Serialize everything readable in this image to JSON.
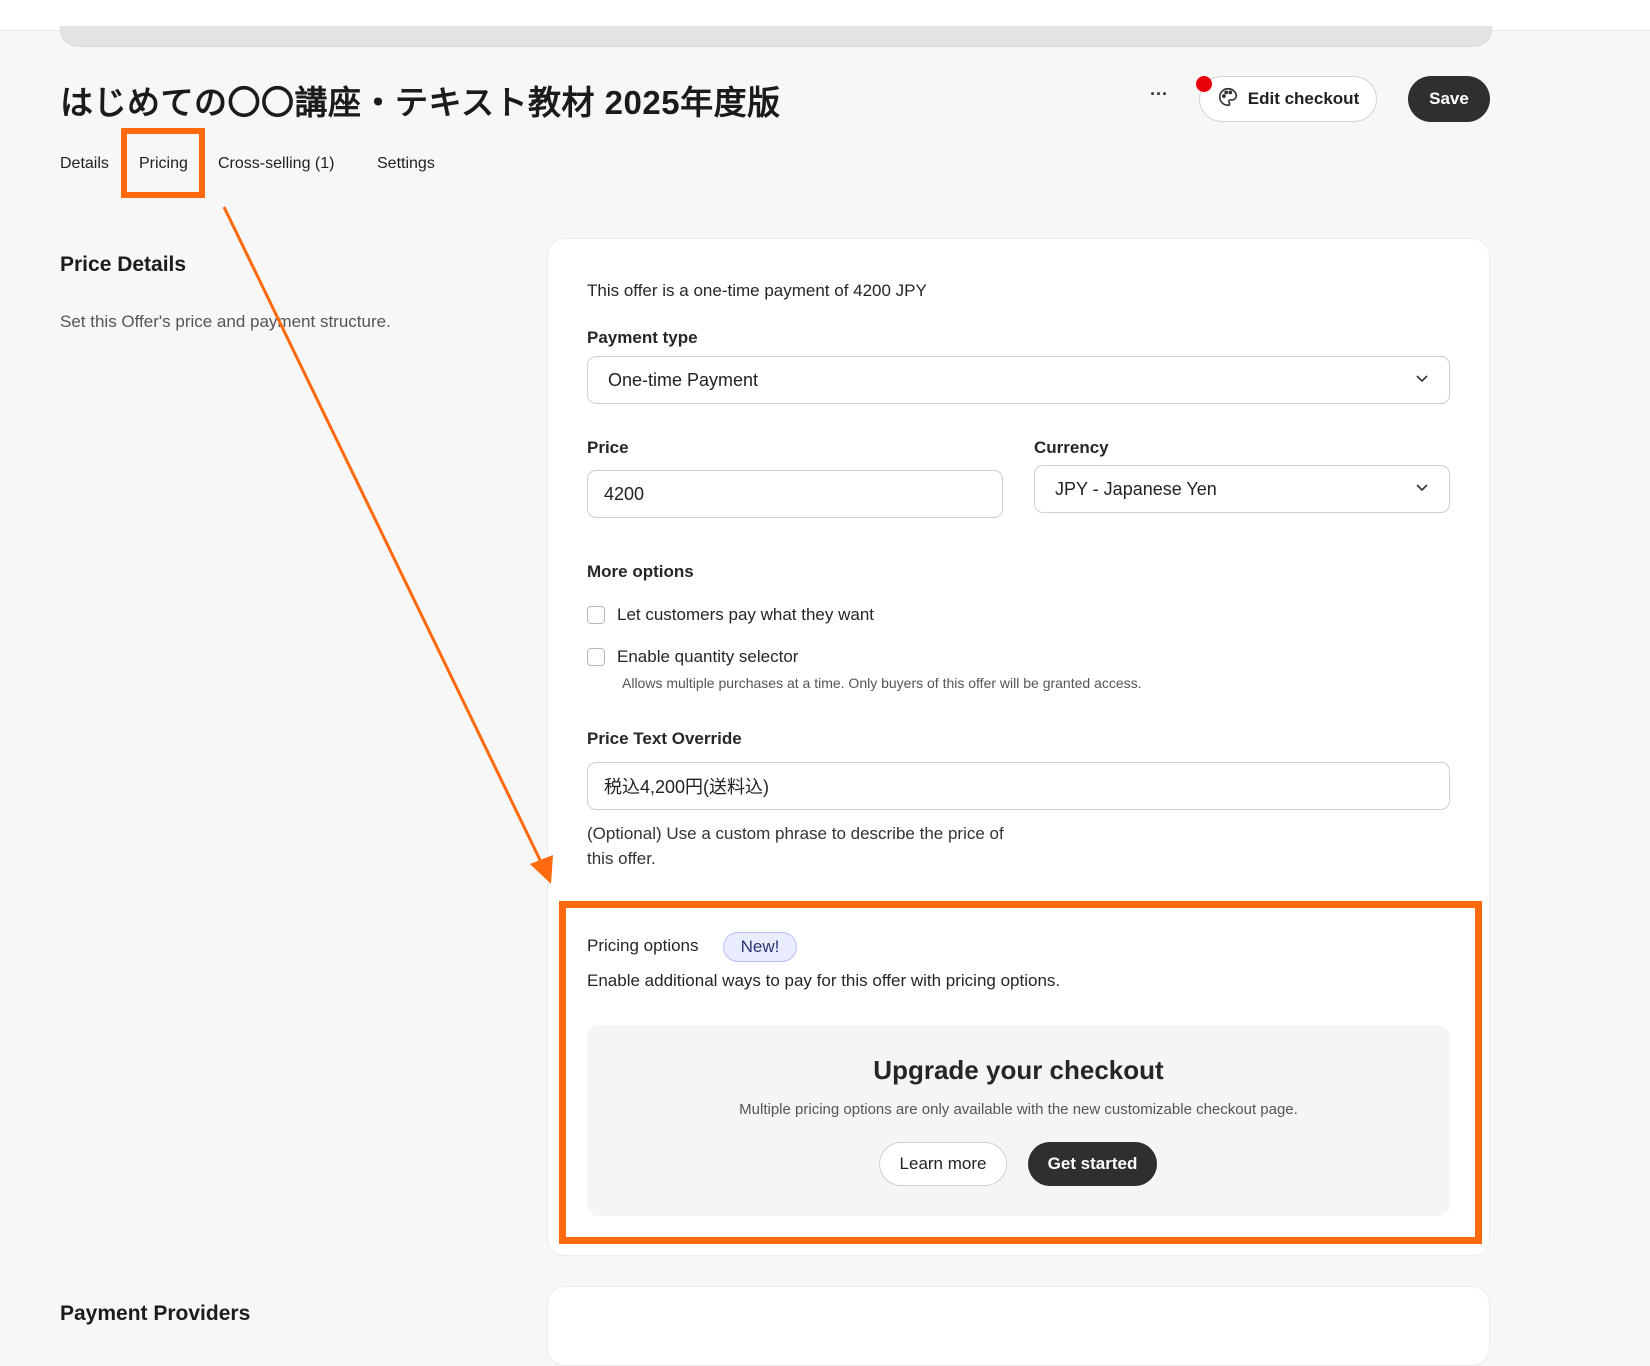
{
  "page": {
    "title": "はじめての〇〇講座・テキスト教材 2025年度版"
  },
  "header": {
    "more_label": "···",
    "edit_checkout_label": "Edit checkout",
    "save_label": "Save"
  },
  "tabs": [
    {
      "label": "Details"
    },
    {
      "label": "Pricing"
    },
    {
      "label": "Cross-selling (1)"
    },
    {
      "label": "Settings"
    }
  ],
  "sidebar": {
    "price_details_title": "Price Details",
    "price_details_sub": "Set this Offer's price and payment structure.",
    "payment_providers_title": "Payment Providers"
  },
  "pricing": {
    "summary": "This offer is a one-time payment of 4200 JPY",
    "payment_type_label": "Payment type",
    "payment_type_value": "One-time Payment",
    "price_label": "Price",
    "price_value": "4200",
    "currency_label": "Currency",
    "currency_value": "JPY - Japanese Yen",
    "more_options_label": "More options",
    "option_pay_what_you_want": "Let customers pay what they want",
    "option_quantity_selector": "Enable quantity selector",
    "quantity_note": "Allows multiple purchases at a time. Only buyers of this offer will be granted access.",
    "price_override_label": "Price Text Override",
    "price_override_value": "税込4,200円(送料込)",
    "price_override_help": "(Optional) Use a custom phrase to describe the price of this offer."
  },
  "pricing_options": {
    "title": "Pricing options",
    "badge": "New!",
    "description": "Enable additional ways to pay for this offer with pricing options.",
    "upgrade_title": "Upgrade your checkout",
    "upgrade_sub": "Multiple pricing options are only available with the new customizable checkout page.",
    "learn_more_label": "Learn more",
    "get_started_label": "Get started"
  },
  "annotation": {
    "highlight_color": "#ff6a0e"
  },
  "icons": {
    "edit_checkout": "palette-icon",
    "dropdown": "chevron-down-icon"
  }
}
